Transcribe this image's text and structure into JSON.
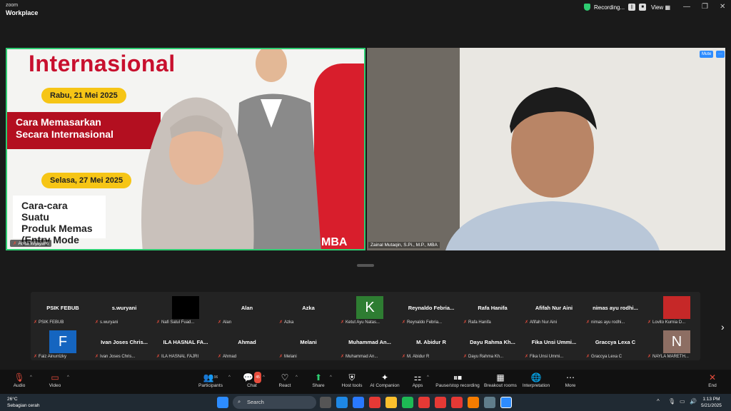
{
  "app": {
    "brand_small": "zoom",
    "brand_big": "Workplace"
  },
  "titlebar": {
    "recording_label": "Recording...",
    "view_label": "View"
  },
  "tile1": {
    "name": "Anita Wijayanti",
    "poster": {
      "heading": "Internasional",
      "date1": "Rabu, 21 Mei 2025",
      "topic1_line1": "Cara Memasarkan",
      "topic1_line2": "Secara Internasional",
      "date2": "Selasa, 27 Mei 2025",
      "topic2_line1": "Cara-cara Suatu",
      "topic2_line2": "Produk Memas",
      "topic2_line3": "(Entry Mode",
      "logo": "MBA"
    }
  },
  "tile2": {
    "name": "Zainal Mutaqin, S.Pi., M.P., MBA",
    "mute_label": "Mute"
  },
  "gallery": {
    "cells": [
      {
        "title": "PSIK FEBUB",
        "tag": "PSIK FEBUB"
      },
      {
        "title": "s.wuryani",
        "tag": "s.wuryani"
      },
      {
        "title": "",
        "tag": "Nafi Satul Fuad...",
        "avatar": "black"
      },
      {
        "title": "Alan",
        "tag": "Alan"
      },
      {
        "title": "Azka",
        "tag": "Azka"
      },
      {
        "title": "",
        "tag": "Ketut Ayu Natas...",
        "avatar_letter": "K",
        "avatar_color": "#2e7d32"
      },
      {
        "title": "Reynaldo  Febria...",
        "tag": "Reynaldo Febria..."
      },
      {
        "title": "Rafa Hanifa",
        "tag": "Rafa Hanifa"
      },
      {
        "title": "Afifah Nur Aini",
        "tag": "Afifah Nur Aini"
      },
      {
        "title": "nimas ayu rodhi...",
        "tag": "nimas ayu rodhi..."
      },
      {
        "title": "",
        "tag": "Lovito Kurnia D...",
        "avatar": "photo"
      },
      {
        "title": "",
        "tag": "Faiz Ainurrizky",
        "avatar_letter": "F",
        "avatar_color": "#1565c0"
      },
      {
        "title": "Ivan Joses Chris...",
        "tag": "Ivan Joses Chris..."
      },
      {
        "title": "ILA HASNAL FA...",
        "tag": "ILA HASNAL FAJRI"
      },
      {
        "title": "Ahmad",
        "tag": "Ahmad"
      },
      {
        "title": "Melani",
        "tag": "Melani"
      },
      {
        "title": "Muhammad  An...",
        "tag": "Muhammad An..."
      },
      {
        "title": "M. Abidur R",
        "tag": "M. Abidur R"
      },
      {
        "title": "Dayu Rahma Kh...",
        "tag": "Dayu Rahma Kh..."
      },
      {
        "title": "Fika Unsi Ummi...",
        "tag": "Fika Unsi Ummi..."
      },
      {
        "title": "Graccya Lexa C",
        "tag": "Graccya Lexa C"
      },
      {
        "title": "",
        "tag": "NAYLA MARETH...",
        "avatar_letter": "N",
        "avatar_color": "#8d6e63"
      }
    ]
  },
  "toolbar": {
    "audio": "Audio",
    "video": "Video",
    "participants": "Participants",
    "participants_count": "96",
    "chat": "Chat",
    "chat_badge": "45",
    "react": "React",
    "share": "Share",
    "host_tools": "Host tools",
    "ai_companion": "AI Companion",
    "apps": "Apps",
    "recording": "Pause/stop recording",
    "breakout": "Breakout rooms",
    "interpretation": "Interpretation",
    "more": "More",
    "end": "End"
  },
  "taskbar": {
    "temp": "26°C",
    "weather": "Sebagian cerah",
    "search": "Search",
    "time": "1:13 PM",
    "date": "5/21/2025"
  },
  "colors": {
    "accent_green": "#2ecc71",
    "brand_red": "#c8102e",
    "pill_yellow": "#f6c516"
  }
}
